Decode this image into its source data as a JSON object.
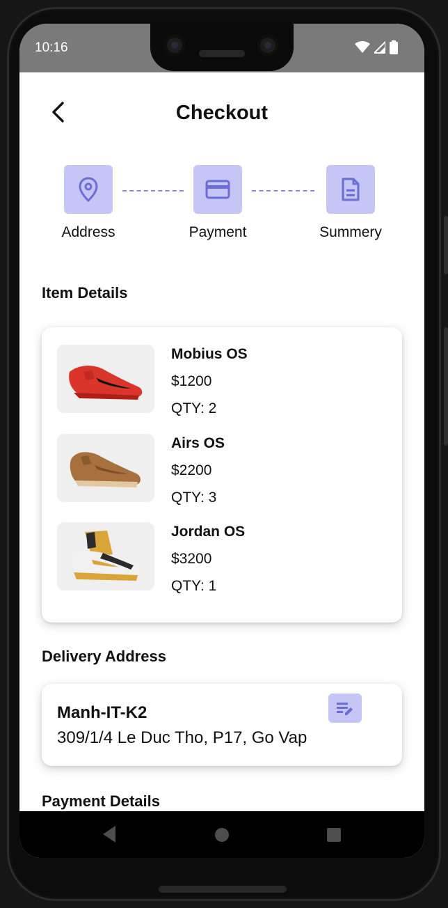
{
  "status_bar": {
    "time": "10:16"
  },
  "header": {
    "title": "Checkout"
  },
  "steps": [
    {
      "label": "Address",
      "icon": "location-pin-icon"
    },
    {
      "label": "Payment",
      "icon": "credit-card-icon"
    },
    {
      "label": "Summery",
      "icon": "document-icon"
    }
  ],
  "sections": {
    "items": "Item Details",
    "delivery": "Delivery Address",
    "payment": "Payment Details"
  },
  "items": [
    {
      "name": "Mobius OS",
      "price": "$1200",
      "qty": "QTY: 2",
      "shoe_color": "#d9352b"
    },
    {
      "name": "Airs OS",
      "price": "$2200",
      "qty": "QTY: 3",
      "shoe_color": "#a8703d"
    },
    {
      "name": "Jordan OS",
      "price": "$3200",
      "qty": "QTY: 1",
      "shoe_color": "#d9a53a"
    }
  ],
  "address": {
    "name": "Manh-IT-K2",
    "line": "309/1/4 Le Duc Tho, P17, Go Vap"
  },
  "colors": {
    "accent_bg": "#c5c5f6",
    "accent_icon": "#6c6cd6"
  }
}
